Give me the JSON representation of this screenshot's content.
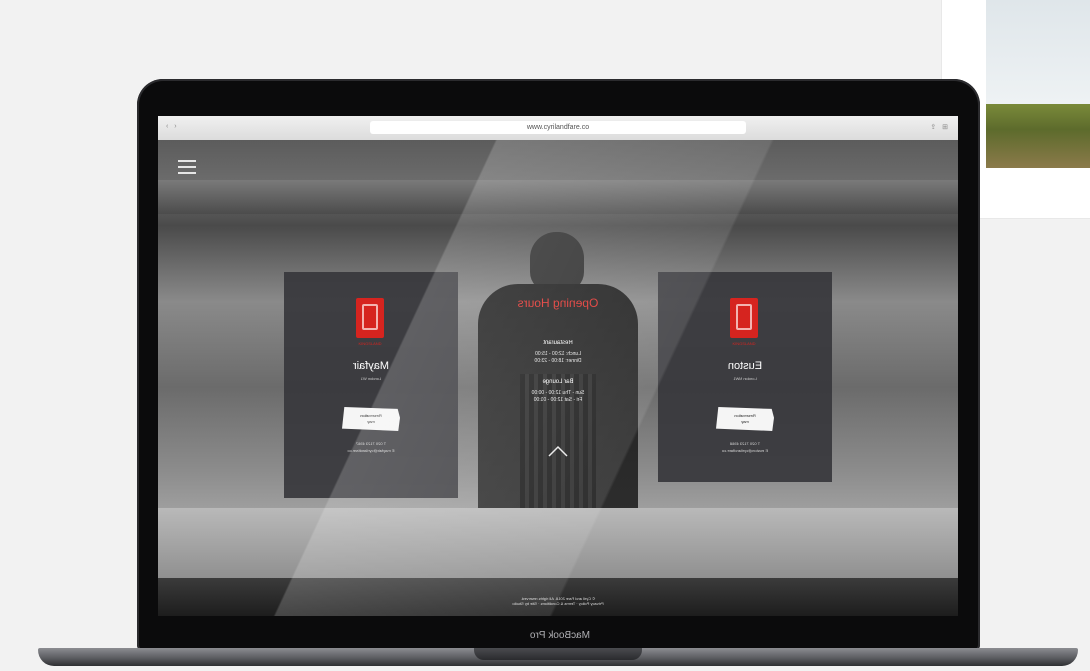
{
  "device": {
    "bezel_label": "MacBook Pro"
  },
  "browser": {
    "url": "www.cyrilandfare.co"
  },
  "page": {
    "menu_icon": "hamburger-icon",
    "hours": {
      "title": "Opening Hours",
      "restaurant_heading": "Restaurant",
      "restaurant_lines": [
        "Lunch: 12:00 - 15:00",
        "Dinner: 18:00 - 23:00"
      ],
      "bar_heading": "Bar Lounge",
      "bar_lines": [
        "Sun - Thu 12:00 - 00:00",
        "Fri - Sat 12:00 - 01:00"
      ]
    },
    "locations": [
      {
        "name": "Mayfair",
        "sub": "London W1",
        "logo_caption": "KINGSLAND",
        "reserve_label": "Reservation\nmay",
        "contact": [
          "T 020 7123 4567",
          "E mayfair@cyrilandfare.co"
        ]
      },
      {
        "name": "Euston",
        "sub": "London NW1",
        "logo_caption": "KINGSLAND",
        "reserve_label": "Reservation\nmay",
        "contact": [
          "T 020 7123 4568",
          "E euston@cyrilandfare.co"
        ]
      }
    ],
    "footer": [
      "© Cyril and Fare 2018. All rights reserved.",
      "Privacy Policy · Terms & Conditions · Site by Studio"
    ]
  },
  "colors": {
    "accent_red": "#e0312d",
    "card_bg": "#37373c"
  }
}
